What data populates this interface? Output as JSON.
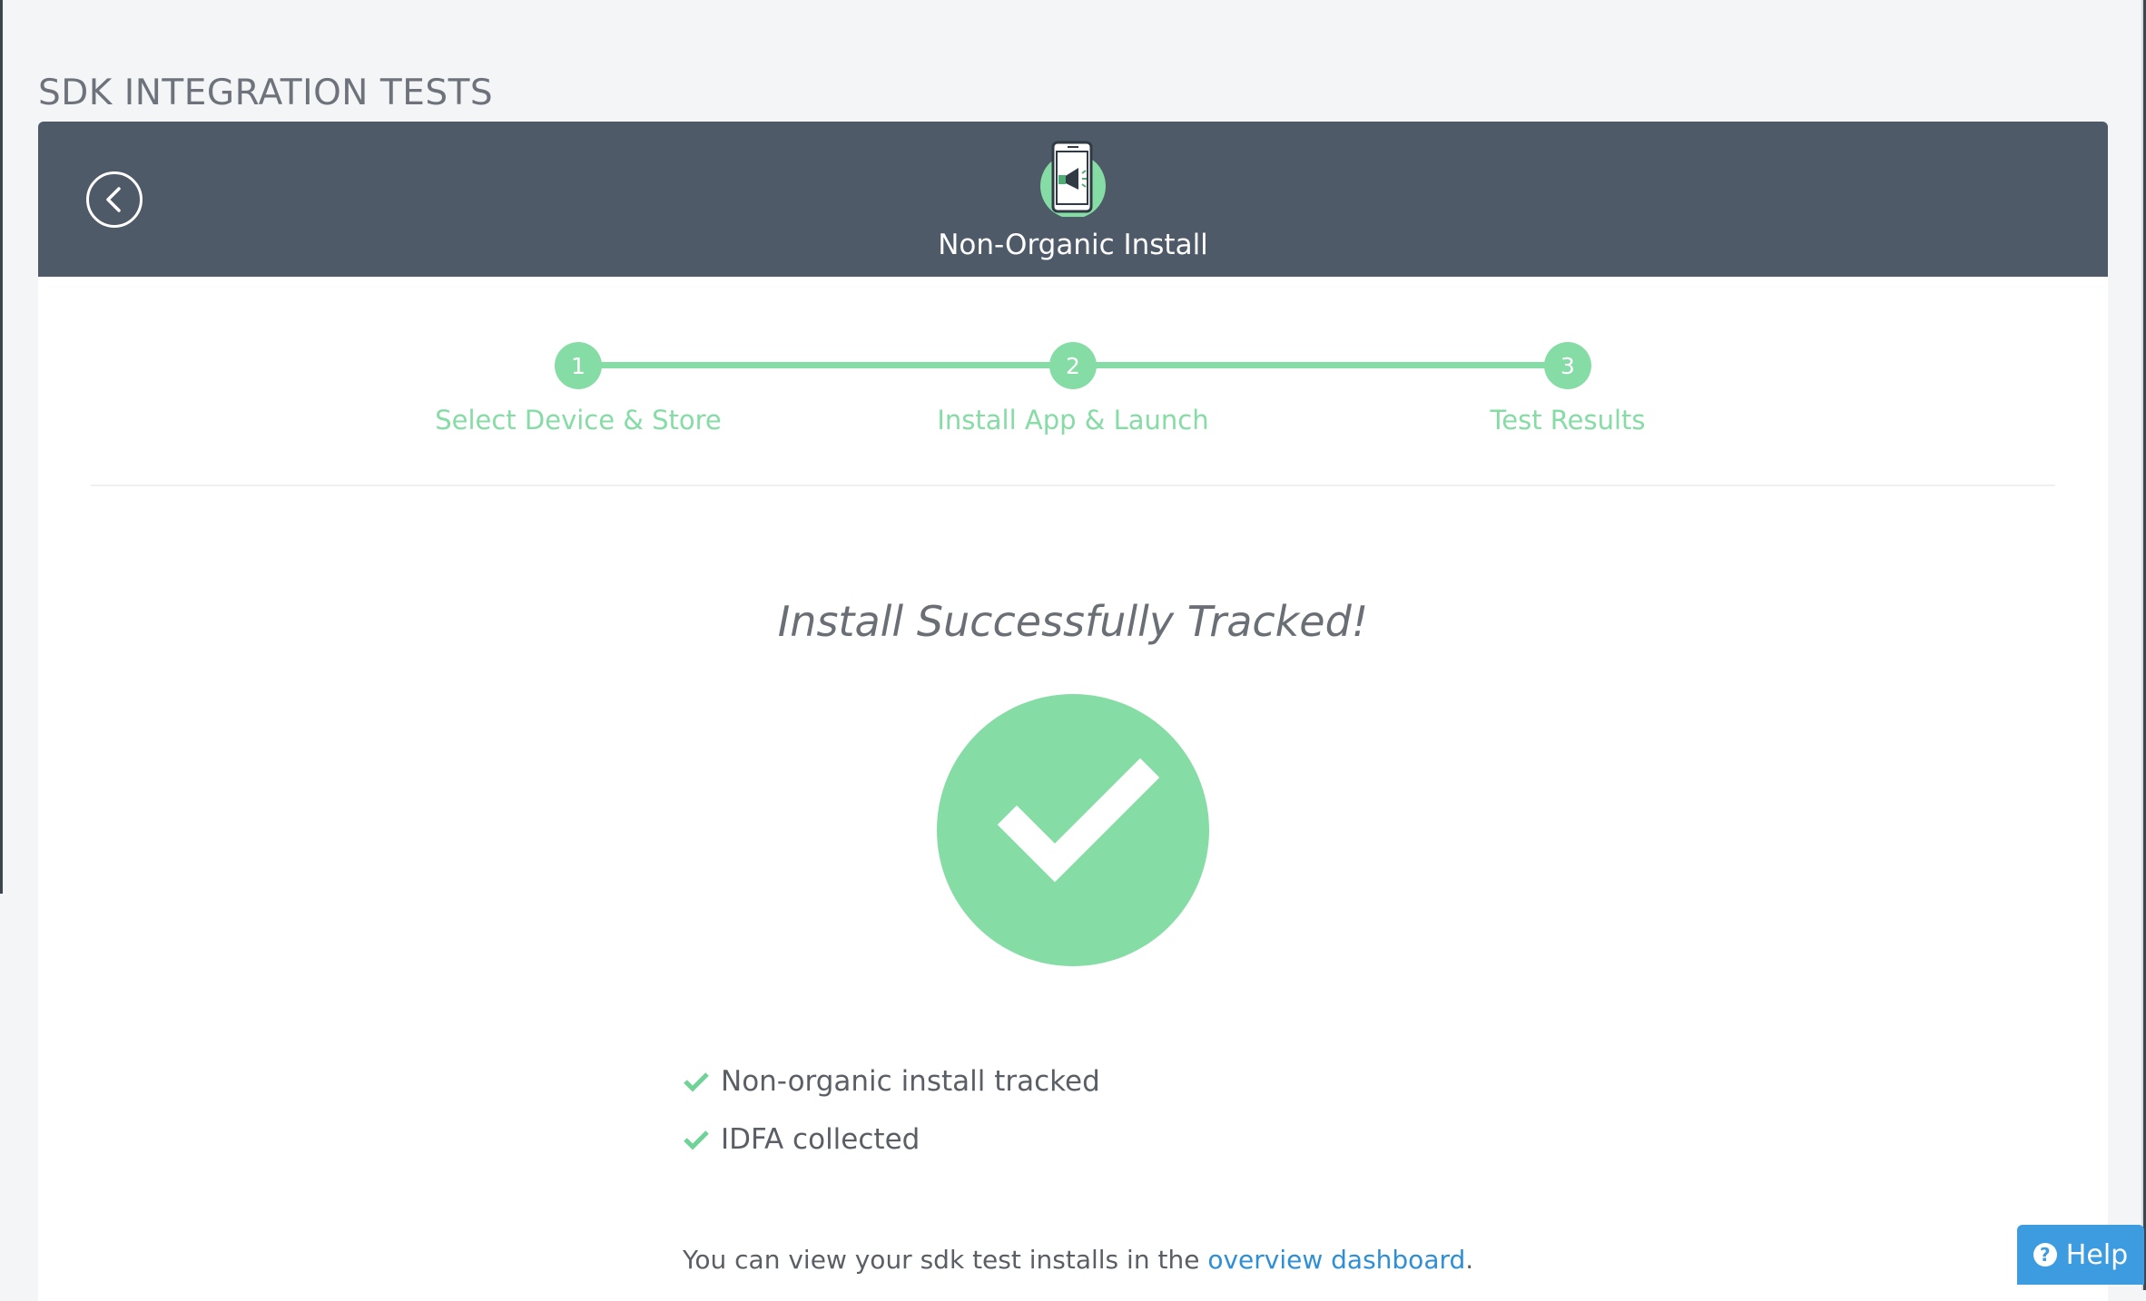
{
  "page": {
    "title": "SDK INTEGRATION TESTS"
  },
  "header": {
    "back_icon": "chevron-left-circle-icon",
    "icon": "phone-megaphone-icon",
    "title": "Non-Organic Install"
  },
  "stepper": {
    "color": "#85dca4",
    "steps": [
      {
        "number": "1",
        "label": "Select Device & Store"
      },
      {
        "number": "2",
        "label": "Install App & Launch"
      },
      {
        "number": "3",
        "label": "Test Results"
      }
    ]
  },
  "result": {
    "title": "Install Successfully Tracked!",
    "icon": "large-checkmark-icon",
    "checks": [
      "Non-organic install tracked",
      "IDFA collected"
    ]
  },
  "footer": {
    "text_before": "You can view your sdk test installs in the ",
    "link_text": "overview dashboard",
    "text_after": "."
  },
  "help": {
    "label": "Help",
    "icon": "question-circle-icon",
    "color": "#3d9be0"
  }
}
